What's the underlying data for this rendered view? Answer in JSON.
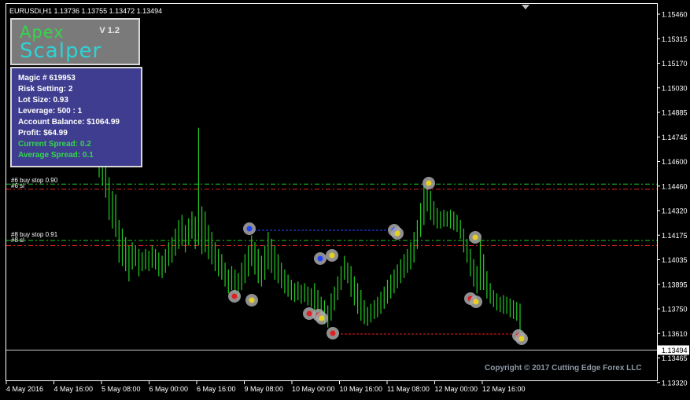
{
  "window": {
    "symbol_info": "EURUSDi,H1  1.13736 1.13755 1.13472 1.13494"
  },
  "panel": {
    "title_top": "Apex",
    "title_bottom": "Scalper",
    "version": "V 1.2",
    "rows": [
      "Magic # 619953",
      "Risk Setting: 2",
      "Lot Size: 0.93",
      "Leverage: 500 : 1",
      "Account Balance: $1064.99",
      "Profit: $64.99"
    ],
    "spread_rows": [
      "Current Spread:  0.2",
      "Average Spread:  0.1"
    ]
  },
  "orders": [
    {
      "label": "#6 buy stop 0.90",
      "sl_label": "#6 sl",
      "price": 1.1446,
      "sl_price": 1.1443
    },
    {
      "label": "#8 buy stop 0.91",
      "sl_label": "#8 sl",
      "price": 1.1413,
      "sl_price": 1.141
    }
  ],
  "price_axis": {
    "ticks": [
      "1.15460",
      "1.15315",
      "1.15170",
      "1.15030",
      "1.14885",
      "1.14745",
      "1.14600",
      "1.14460",
      "1.14320",
      "1.14175",
      "1.14035",
      "1.13895",
      "1.13750",
      "1.13610",
      "1.13465",
      "1.13320"
    ],
    "current_price": "1.13494"
  },
  "time_axis": {
    "ticks": [
      "4 May 2016",
      "4 May 16:00",
      "5 May 08:00",
      "6 May 00:00",
      "6 May 16:00",
      "9 May 08:00",
      "10 May 00:00",
      "10 May 16:00",
      "11 May 08:00",
      "12 May 00:00",
      "12 May 16:00"
    ]
  },
  "chart_data": {
    "type": "bar",
    "title": "EURUSDi,H1",
    "colors": {
      "bars": "#22cc22",
      "grid": "#ffffff",
      "buy_stop": "#22cc22",
      "stop_loss": "#e02020",
      "trade_link_blue": "#2244ff",
      "trade_link_red": "#e02020"
    },
    "ylim": [
      1.1332,
      1.1546
    ],
    "bars": [
      [
        1.1483,
        1.145
      ],
      [
        1.147,
        1.1445
      ],
      [
        1.1458,
        1.1438
      ],
      [
        1.145,
        1.1425
      ],
      [
        1.1442,
        1.142
      ],
      [
        1.144,
        1.1415
      ],
      [
        1.1425,
        1.14
      ],
      [
        1.142,
        1.1398
      ],
      [
        1.1415,
        1.1395
      ],
      [
        1.141,
        1.1389
      ],
      [
        1.1412,
        1.1396
      ],
      [
        1.141,
        1.1398
      ],
      [
        1.1408,
        1.1392
      ],
      [
        1.1406,
        1.1395
      ],
      [
        1.1408,
        1.1396
      ],
      [
        1.1407,
        1.1395
      ],
      [
        1.141,
        1.1397
      ],
      [
        1.1408,
        1.1396
      ],
      [
        1.1406,
        1.1392
      ],
      [
        1.1404,
        1.1391
      ],
      [
        1.1408,
        1.1394
      ],
      [
        1.1412,
        1.1398
      ],
      [
        1.1415,
        1.14
      ],
      [
        1.142,
        1.1404
      ],
      [
        1.1425,
        1.1408
      ],
      [
        1.1428,
        1.141
      ],
      [
        1.1422,
        1.1406
      ],
      [
        1.1426,
        1.141
      ],
      [
        1.143,
        1.1414
      ],
      [
        1.1427,
        1.1408
      ],
      [
        1.1479,
        1.141
      ],
      [
        1.1433,
        1.1405
      ],
      [
        1.143,
        1.1406
      ],
      [
        1.1422,
        1.1402
      ],
      [
        1.1418,
        1.1399
      ],
      [
        1.1412,
        1.1395
      ],
      [
        1.1408,
        1.1392
      ],
      [
        1.1405,
        1.139
      ],
      [
        1.14,
        1.1386
      ],
      [
        1.1396,
        1.1382
      ],
      [
        1.1398,
        1.1384
      ],
      [
        1.1396,
        1.1381
      ],
      [
        1.1394,
        1.138
      ],
      [
        1.14,
        1.1384
      ],
      [
        1.1405,
        1.1388
      ],
      [
        1.141,
        1.1392
      ],
      [
        1.1416,
        1.1398
      ],
      [
        1.1412,
        1.1393
      ],
      [
        1.1408,
        1.1388
      ],
      [
        1.1404,
        1.1386
      ],
      [
        1.141,
        1.139
      ],
      [
        1.1418,
        1.1396
      ],
      [
        1.1414,
        1.1394
      ],
      [
        1.141,
        1.139
      ],
      [
        1.1405,
        1.1388
      ],
      [
        1.14,
        1.1385
      ],
      [
        1.1396,
        1.1382
      ],
      [
        1.1393,
        1.138
      ],
      [
        1.139,
        1.1378
      ],
      [
        1.1388,
        1.1377
      ],
      [
        1.1389,
        1.1378
      ],
      [
        1.1387,
        1.1376
      ],
      [
        1.1388,
        1.1377
      ],
      [
        1.1386,
        1.1375
      ],
      [
        1.1385,
        1.1374
      ],
      [
        1.1388,
        1.1372
      ],
      [
        1.1384,
        1.137
      ],
      [
        1.138,
        1.1366
      ],
      [
        1.1378,
        1.1364
      ],
      [
        1.1375,
        1.1362
      ],
      [
        1.1382,
        1.1366
      ],
      [
        1.1386,
        1.1372
      ],
      [
        1.1392,
        1.1378
      ],
      [
        1.1398,
        1.1384
      ],
      [
        1.1404,
        1.139
      ],
      [
        1.14,
        1.1388
      ],
      [
        1.1398,
        1.138
      ],
      [
        1.1392,
        1.1375
      ],
      [
        1.1388,
        1.137
      ],
      [
        1.1384,
        1.1366
      ],
      [
        1.1378,
        1.1364
      ],
      [
        1.1374,
        1.1363
      ],
      [
        1.1376,
        1.1365
      ],
      [
        1.1378,
        1.1367
      ],
      [
        1.138,
        1.1368
      ],
      [
        1.1383,
        1.137
      ],
      [
        1.1386,
        1.1373
      ],
      [
        1.139,
        1.1376
      ],
      [
        1.1393,
        1.1379
      ],
      [
        1.1396,
        1.1382
      ],
      [
        1.1399,
        1.1385
      ],
      [
        1.1402,
        1.1388
      ],
      [
        1.1405,
        1.1391
      ],
      [
        1.1408,
        1.1394
      ],
      [
        1.1412,
        1.1396
      ],
      [
        1.1418,
        1.14
      ],
      [
        1.1425,
        1.1408
      ],
      [
        1.1435,
        1.1415
      ],
      [
        1.1446,
        1.1422
      ],
      [
        1.1448,
        1.143
      ],
      [
        1.1442,
        1.1425
      ],
      [
        1.1436,
        1.1422
      ],
      [
        1.1432,
        1.142
      ],
      [
        1.143,
        1.142
      ],
      [
        1.1431,
        1.1421
      ],
      [
        1.143,
        1.1421
      ],
      [
        1.1431,
        1.142
      ],
      [
        1.143,
        1.1419
      ],
      [
        1.1428,
        1.1418
      ],
      [
        1.1425,
        1.1414
      ],
      [
        1.142,
        1.1406
      ],
      [
        1.1414,
        1.14
      ],
      [
        1.1408,
        1.1392
      ],
      [
        1.1402,
        1.1386
      ],
      [
        1.1398,
        1.1382
      ],
      [
        1.1413,
        1.1384
      ],
      [
        1.1405,
        1.1384
      ],
      [
        1.1395,
        1.1379
      ],
      [
        1.1388,
        1.1376
      ],
      [
        1.1384,
        1.1374
      ],
      [
        1.1382,
        1.1372
      ],
      [
        1.138,
        1.1371
      ],
      [
        1.1381,
        1.137
      ],
      [
        1.138,
        1.137
      ],
      [
        1.1379,
        1.1368
      ],
      [
        1.1378,
        1.1367
      ],
      [
        1.1377,
        1.1366
      ],
      [
        1.1376,
        1.1356
      ]
    ]
  }
}
